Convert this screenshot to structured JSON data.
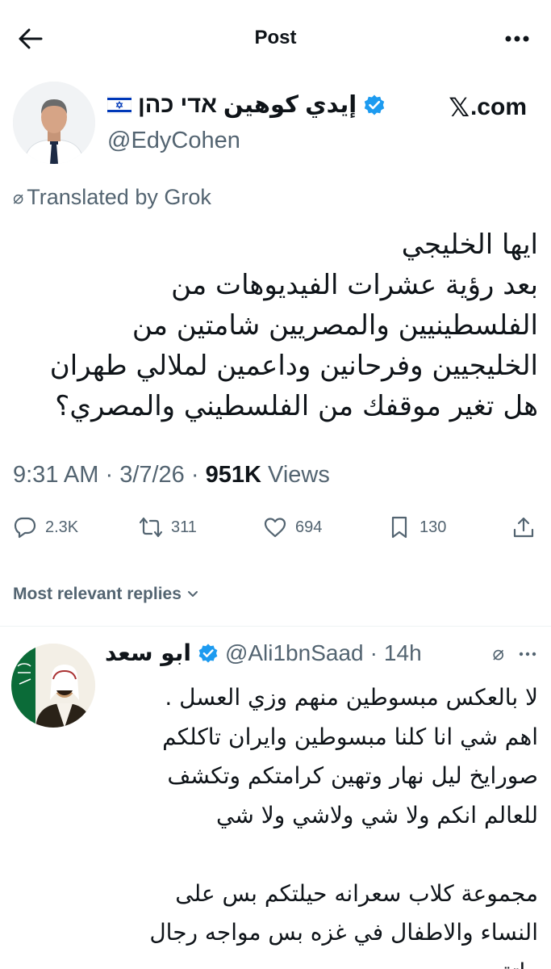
{
  "header": {
    "title": "Post"
  },
  "post": {
    "author_name": "إيدي كوهين אדי כהן",
    "author_handle": "@EdyCohen",
    "source_badge": ".com",
    "translated_label": "Translated by Grok",
    "body_lines": [
      "ايها الخليجي",
      "بعد رؤية عشرات الفيديوهات من",
      "الفلسطينيين والمصريين شامتين من",
      "الخليجيين وفرحانين وداعمين لملالي طهران",
      "هل تغير موقفك من الفلسطيني والمصري؟"
    ],
    "time": "9:31 AM",
    "date": "3/7/26",
    "views_count": "951K",
    "views_label": "Views",
    "replies_count": "2.3K",
    "reposts_count": "311",
    "likes_count": "694",
    "bookmarks_count": "130"
  },
  "replies_sort": {
    "label": "Most relevant replies"
  },
  "reply": {
    "author_name": "ابو سعد",
    "author_handle": "@Ali1bnSaad",
    "age": "14h",
    "body_lines": [
      "لا بالعكس مبسوطين منهم وزي العسل .",
      "اهم شي انا كلنا مبسوطين وايران تاكلكم",
      "صورايخ ليل نهار وتهين كرامتكم  وتكشف",
      "للعالم انكم ولا شي ولاشي ولا شي",
      "",
      "مجموعة كلاب سعرانه حيلتكم بس على",
      "النساء والاطفال في غزه بس مواجه رجال",
      "ماتقدرون"
    ]
  },
  "colors": {
    "text": "#0f1419",
    "secondary": "#536471",
    "verified": "#1d9bf0",
    "divider": "#eff3f4"
  }
}
